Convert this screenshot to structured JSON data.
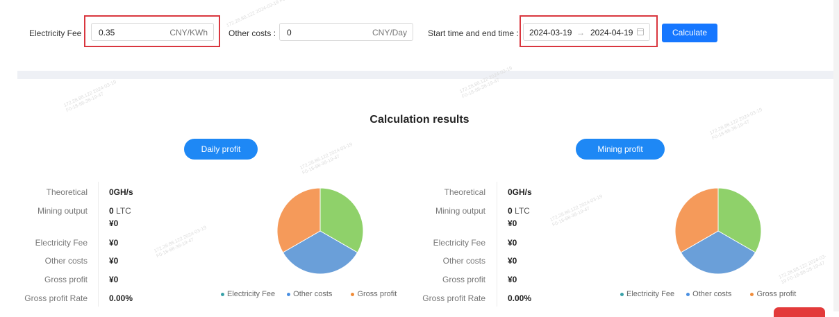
{
  "form": {
    "electricity_fee_label": "Electricity Fee",
    "electricity_fee_value": "0.35",
    "electricity_fee_unit": "CNY/KWh",
    "other_costs_label": "Other costs :",
    "other_costs_value": "0",
    "other_costs_unit": "CNY/Day",
    "time_label": "Start time and end time :",
    "start_date": "2024-03-19",
    "date_separator": "→",
    "end_date": "2024-04-19",
    "calculate_label": "Calculate"
  },
  "results_title": "Calculation results",
  "panels": [
    {
      "button": "Daily profit",
      "stats": {
        "theoretical_label": "Theoretical",
        "theoretical_value": "0GH/s",
        "mining_output_label": "Mining output",
        "mining_output_value": "0",
        "mining_output_unit": "LTC",
        "mining_output_cny": "¥0",
        "electricity_fee_label": "Electricity Fee",
        "electricity_fee_value": "¥0",
        "other_costs_label": "Other costs",
        "other_costs_value": "¥0",
        "gross_profit_label": "Gross profit",
        "gross_profit_value": "¥0",
        "gross_profit_rate_label": "Gross profit Rate",
        "gross_profit_rate_value": "0.00%"
      }
    },
    {
      "button": "Mining profit",
      "stats": {
        "theoretical_label": "Theoretical",
        "theoretical_value": "0GH/s",
        "mining_output_label": "Mining output",
        "mining_output_value": "0",
        "mining_output_unit": "LTC",
        "mining_output_cny": "¥0",
        "electricity_fee_label": "Electricity Fee",
        "electricity_fee_value": "¥0",
        "other_costs_label": "Other costs",
        "other_costs_value": "¥0",
        "gross_profit_label": "Gross profit",
        "gross_profit_value": "¥0",
        "gross_profit_rate_label": "Gross profit Rate",
        "gross_profit_rate_value": "0.00%"
      }
    }
  ],
  "chart_data": [
    {
      "type": "pie",
      "series": [
        {
          "name": "Electricity Fee",
          "value": 1,
          "color": "#8fd16a"
        },
        {
          "name": "Other costs",
          "value": 1,
          "color": "#6a9fd9"
        },
        {
          "name": "Gross profit",
          "value": 1,
          "color": "#f59a5a"
        }
      ]
    },
    {
      "type": "pie",
      "series": [
        {
          "name": "Electricity Fee",
          "value": 1,
          "color": "#8fd16a"
        },
        {
          "name": "Other costs",
          "value": 1,
          "color": "#6a9fd9"
        },
        {
          "name": "Gross profit",
          "value": 1,
          "color": "#f59a5a"
        }
      ]
    }
  ],
  "legend_colors": {
    "electricity": "#3aa1a8",
    "other": "#4a90e2",
    "gross": "#f08c3a"
  },
  "accent": "#1677ff",
  "watermark_text": "172.28.88.122 2024-03-19 F0-18-88-38-19-47"
}
